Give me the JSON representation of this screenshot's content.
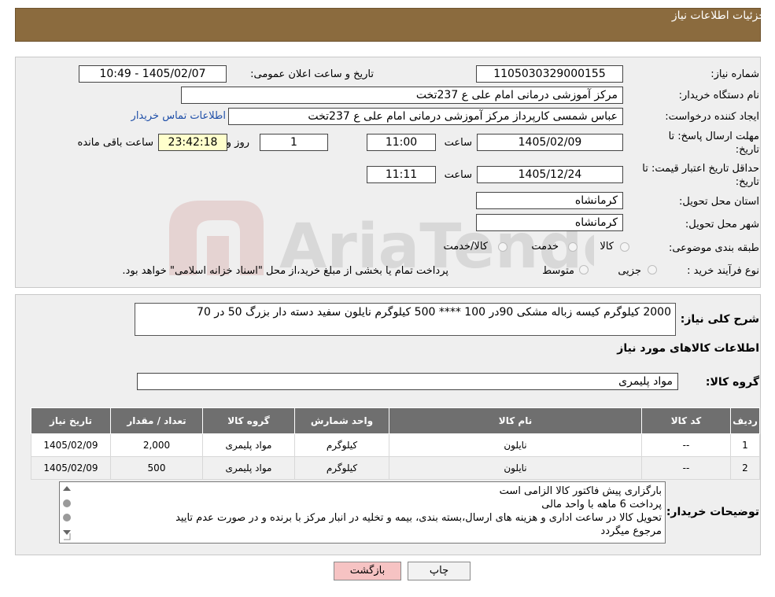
{
  "header": {
    "title": "جزئیات اطلاعات نیاز"
  },
  "watermark": {
    "text": "AriaTender.neT"
  },
  "form": {
    "need_number_label": "شماره نیاز:",
    "need_number": "1105030329000155",
    "announce_label": "تاریخ و ساعت اعلان عمومی:",
    "announce_value": "1405/02/07 - 10:49",
    "buyer_org_label": "نام دستگاه خریدار:",
    "buyer_org": "مرکز آموزشی درمانی امام علی ع 237تخت",
    "requester_label": "ایجاد کننده درخواست:",
    "requester": "عباس شمسی کارپرداز  مرکز آموزشی درمانی امام علی ع 237تخت",
    "contact_link": "اطلاعات تماس خریدار",
    "deadline_label_1": "مهلت ارسال پاسخ: تا",
    "deadline_label_2": "تاریخ:",
    "deadline_date": "1405/02/09",
    "time_label": "ساعت",
    "deadline_time": "11:00",
    "days_value": "1",
    "days_label": "روز و",
    "remaining_value": "23:42:18",
    "remaining_label": "ساعت باقی مانده",
    "validity_label_1": "حداقل تاریخ اعتبار قیمت: تا",
    "validity_label_2": "تاریخ:",
    "validity_date": "1405/12/24",
    "validity_time_label": "ساعت",
    "validity_time": "11:11",
    "province_label": "استان محل تحویل:",
    "province": "کرمانشاه",
    "city_label": "شهر محل تحویل:",
    "city": "کرمانشاه",
    "category_label": "طبقه بندی موضوعی:",
    "category_options": [
      "کالا",
      "خدمت",
      "کالا/خدمت"
    ],
    "process_label": "نوع فرآیند خرید :",
    "process_options": [
      "جزیی",
      "متوسط"
    ],
    "process_note": "پرداخت تمام یا بخشی از مبلغ خرید،از محل \"اسناد خزانه اسلامی\" خواهد بود."
  },
  "details": {
    "summary_label": "شرح کلی نیاز:",
    "summary": "2000 کیلوگرم کیسه زباله مشکی 90در 100 **** 500 کیلوگرم نایلون سفید دسته دار بزرگ 50 در 70",
    "goods_info_title": "اطلاعات کالاهای مورد نیاز",
    "goods_group_label": "گروه کالا:",
    "goods_group": "مواد پلیمری"
  },
  "table": {
    "headers": [
      "ردیف",
      "کد کالا",
      "نام کالا",
      "واحد شمارش",
      "گروه کالا",
      "تعداد / مقدار",
      "تاریخ نیاز"
    ],
    "rows": [
      [
        "1",
        "--",
        "نایلون",
        "کیلوگرم",
        "مواد پلیمری",
        "2,000",
        "1405/02/09"
      ],
      [
        "2",
        "--",
        "نایلون",
        "کیلوگرم",
        "مواد پلیمری",
        "500",
        "1405/02/09"
      ]
    ]
  },
  "notes": {
    "label": "توضیحات خریدار:",
    "lines": [
      "بارگزاری پیش فاکتور  کالا الزامی است",
      "پرداخت 6 ماهه با واحد مالی",
      "تحویل کالا در ساعت اداری و هزینه های ارسال،بسته بندی، بیمه و تخلیه در انبار مرکز با برنده و در صورت عدم تایید",
      "مرجوع میگردد"
    ]
  },
  "buttons": {
    "print": "چاپ",
    "back": "بازگشت"
  },
  "colors": {
    "header_bg": "#8b6b3e",
    "panel_bg": "#efefef",
    "table_header": "#6f6f6f",
    "link": "#1f4fa8"
  }
}
